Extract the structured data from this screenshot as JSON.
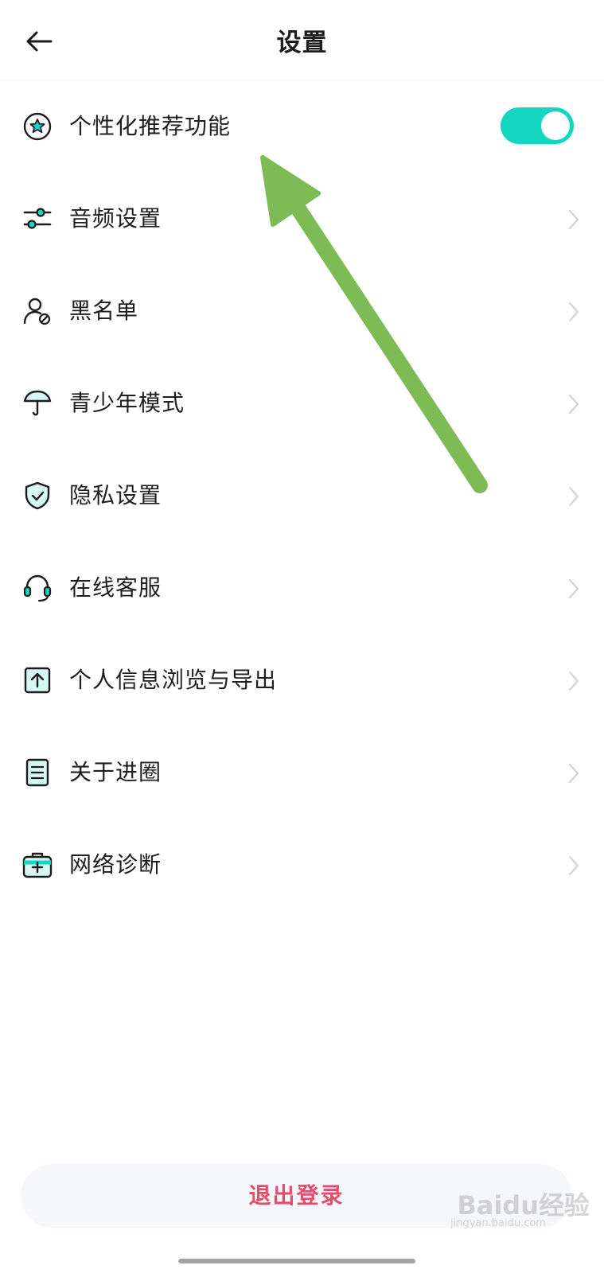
{
  "header": {
    "title": "设置"
  },
  "settings": {
    "items": [
      {
        "label": "个性化推荐功能",
        "icon": "star-circle-icon",
        "control": "toggle",
        "toggle_on": true
      },
      {
        "label": "音频设置",
        "icon": "sliders-icon",
        "control": "chevron"
      },
      {
        "label": "黑名单",
        "icon": "user-blocked-icon",
        "control": "chevron"
      },
      {
        "label": "青少年模式",
        "icon": "umbrella-icon",
        "control": "chevron"
      },
      {
        "label": "隐私设置",
        "icon": "shield-check-icon",
        "control": "chevron"
      },
      {
        "label": "在线客服",
        "icon": "headset-icon",
        "control": "chevron"
      },
      {
        "label": "个人信息浏览与导出",
        "icon": "export-icon",
        "control": "chevron"
      },
      {
        "label": "关于进圈",
        "icon": "document-icon",
        "control": "chevron"
      },
      {
        "label": "网络诊断",
        "icon": "medical-kit-icon",
        "control": "chevron"
      }
    ]
  },
  "footer": {
    "logout_label": "退出登录"
  },
  "watermark": {
    "text": "Baidu经验",
    "sub": "jingyan.baidu.com"
  },
  "colors": {
    "accent": "#15d6c0",
    "logout": "#e84a6b",
    "arrow": "#7dbb55"
  }
}
